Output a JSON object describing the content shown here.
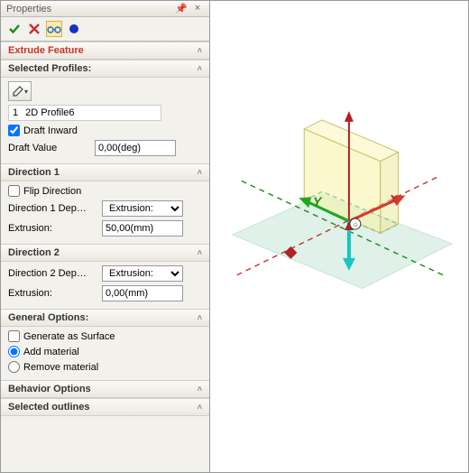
{
  "titlebar": {
    "title": "Properties"
  },
  "feature": {
    "title": "Extrude Feature"
  },
  "profiles": {
    "title": "Selected Profiles:",
    "row_num": "1",
    "row_name": "2D Profile6",
    "draft_inward_label": "Draft Inward",
    "draft_inward_checked": true,
    "draft_value_label": "Draft Value",
    "draft_value": "0,00(deg)"
  },
  "dir1": {
    "title": "Direction 1",
    "flip_label": "Flip Direction",
    "flip_checked": false,
    "depth_label": "Direction 1 Dep…",
    "depth_mode": "Extrusion:",
    "extrusion_label": "Extrusion:",
    "extrusion_value": "50,00(mm)"
  },
  "dir2": {
    "title": "Direction 2",
    "depth_label": "Direction 2 Dep…",
    "depth_mode": "Extrusion:",
    "extrusion_label": "Extrusion:",
    "extrusion_value": "0,00(mm)"
  },
  "general": {
    "title": "General Options:",
    "surface_label": "Generate as Surface",
    "surface_checked": false,
    "add_label": "Add material",
    "add_selected": true,
    "remove_label": "Remove material",
    "remove_selected": false
  },
  "behavior": {
    "title": "Behavior Options"
  },
  "outlines": {
    "title": "Selected outlines"
  },
  "axes": {
    "x": "X",
    "y": "Y"
  }
}
